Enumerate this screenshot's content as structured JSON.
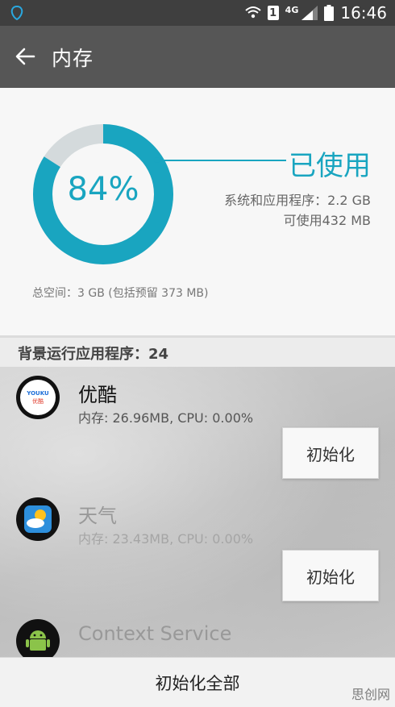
{
  "status": {
    "network": "4G",
    "time": "16:46",
    "sim_badge": "1"
  },
  "header": {
    "title": "内存"
  },
  "summary": {
    "percent": "84%",
    "used_fraction": 0.84,
    "used_label": "已使用",
    "system_apps": "系统和应用程序：2.2 GB",
    "available": "可使用432 MB",
    "total": "总空间：3 GB (包括预留 373 MB)"
  },
  "section": {
    "title": "背景运行应用程序：24"
  },
  "apps": [
    {
      "name": "优酷",
      "meta": "内存: 26.96MB, CPU: 0.00%",
      "button": "初始化",
      "icon": "youku-icon",
      "icon_text_top": "YOUKU",
      "icon_text_bottom": "优酷"
    },
    {
      "name": "天气",
      "meta": "内存: 23.43MB, CPU: 0.00%",
      "button": "初始化",
      "icon": "weather-icon"
    },
    {
      "name": "Context Service",
      "icon": "android-icon"
    }
  ],
  "footer": {
    "clear_all": "初始化全部"
  },
  "watermark": "思创网",
  "colors": {
    "accent": "#19a5c0",
    "statusbar": "#3f3f3f",
    "appbar": "#565656"
  }
}
